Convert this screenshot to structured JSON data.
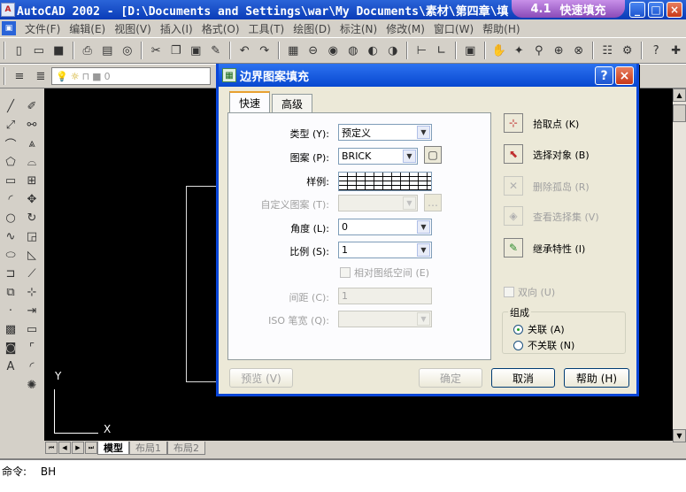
{
  "window": {
    "title": "AutoCAD 2002 - [D:\\Documents and Settings\\war\\My Documents\\素材\\第四章\\填",
    "badge_number": "4.1",
    "badge_text": "快速填充",
    "min": "_",
    "max": "□",
    "close": "×"
  },
  "menu": [
    "文件(F)",
    "编辑(E)",
    "视图(V)",
    "插入(I)",
    "格式(O)",
    "工具(T)",
    "绘图(D)",
    "标注(N)",
    "修改(M)",
    "窗口(W)",
    "帮助(H)"
  ],
  "layer": {
    "value": "0"
  },
  "canvas": {
    "ucs_y": "Y",
    "ucs_x": "X"
  },
  "layout_tabs": [
    "模型",
    "布局1",
    "布局2"
  ],
  "command": {
    "prompt": "命令:",
    "value": "BH"
  },
  "dialog": {
    "title": "边界图案填充",
    "help_btn": "?",
    "close_btn": "×",
    "tabs": [
      "快速",
      "高级"
    ],
    "type_label": "类型 (Y):",
    "type_value": "预定义",
    "pattern_label": "图案 (P):",
    "pattern_value": "BRICK",
    "swatch_label": "样例:",
    "custom_label": "自定义图案 (T):",
    "angle_label": "角度 (L):",
    "angle_value": "0",
    "scale_label": "比例 (S):",
    "scale_value": "1",
    "relative_label": "相对图纸空间 (E)",
    "spacing_label": "间距 (C):",
    "spacing_value": "1",
    "iso_label": "ISO 笔宽 (Q):",
    "pick_points": "拾取点 (K)",
    "select_objects": "选择对象 (B)",
    "remove_islands": "删除孤岛 (R)",
    "view_selections": "查看选择集 (V)",
    "inherit_properties": "继承特性 (I)",
    "double_label": "双向 (U)",
    "composition_title": "组成",
    "associative": "关联 (A)",
    "nonassociative": "不关联 (N)",
    "preview_btn": "预览 (V)",
    "ok_btn": "确定",
    "cancel_btn": "取消",
    "help_btn_label": "帮助 (H)"
  }
}
